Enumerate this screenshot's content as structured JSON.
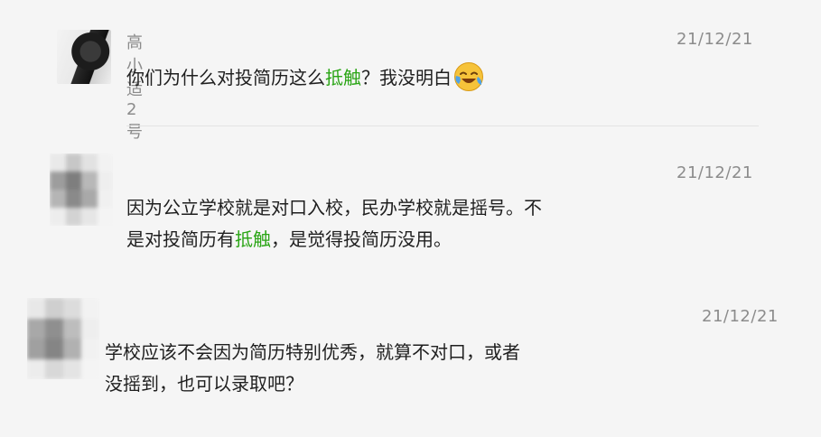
{
  "comments": [
    {
      "name": "高小适2号",
      "time": "21/12/21",
      "text_before": "你们为什么对投简历这么",
      "highlight": "抵触",
      "text_after": "？我没明白",
      "emoji": "face-with-tears-of-joy"
    },
    {
      "time": "21/12/21",
      "line1": "因为公立学校就是对口入校，民办学校就是摇号。不",
      "line2_before": "是对投简历有",
      "highlight": "抵触",
      "line2_after": "，是觉得投简历没用。"
    },
    {
      "time": "21/12/21",
      "line1": "学校应该不会因为简历特别优秀，就算不对口，或者",
      "line2": "没摇到，也可以录取吧？"
    }
  ],
  "colors": {
    "highlight": "#2aa515",
    "meta_text": "#8c8c8c",
    "body_text": "#1f1f1f",
    "background": "#f5f5f5"
  }
}
